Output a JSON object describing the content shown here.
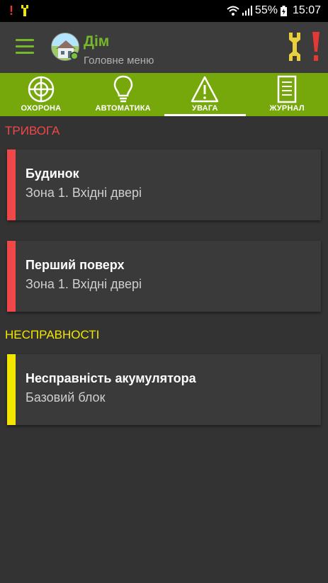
{
  "status_bar": {
    "left_icons": [
      "exclamation-icon",
      "tools-icon"
    ],
    "battery": "55%",
    "time": "15:07"
  },
  "header": {
    "title": "Дім",
    "subtitle": "Головне меню"
  },
  "tabs": [
    {
      "label": "ОХОРОНА",
      "icon": "shield-cross-icon"
    },
    {
      "label": "АВТОМАТИКА",
      "icon": "lightbulb-icon"
    },
    {
      "label": "УВАГА",
      "icon": "warning-triangle-icon",
      "active": true
    },
    {
      "label": "ЖУРНАЛ",
      "icon": "document-icon"
    }
  ],
  "sections": {
    "alarm": {
      "title": "ТРИВОГА",
      "color": "#f04848",
      "items": [
        {
          "title": "Будинок",
          "subtitle": "Зона 1. Вхідні двері"
        },
        {
          "title": "Перший поверх",
          "subtitle": "Зона 1. Вхідні двері"
        }
      ]
    },
    "faults": {
      "title": "НЕСПРАВНОСТІ",
      "color": "#f2e600",
      "items": [
        {
          "title": "Несправність акумулятора",
          "subtitle": "Базовий блок"
        }
      ]
    }
  },
  "colors": {
    "accent": "#76b82a",
    "tab_bar": "#76a80c",
    "alarm": "#f04848",
    "fault": "#f2e600"
  }
}
